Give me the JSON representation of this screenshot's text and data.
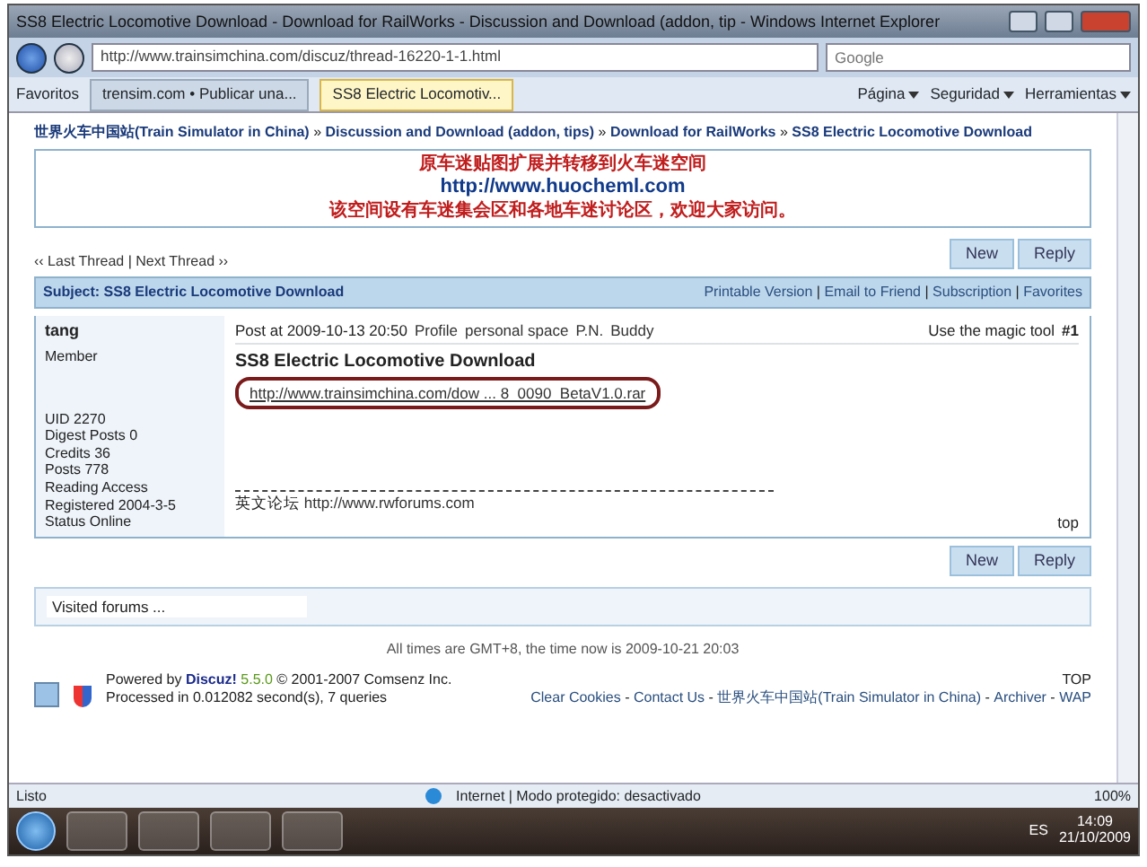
{
  "window": {
    "title": "SS8 Electric Locomotive Download - Download for RailWorks - Discussion and Download (addon, tip - Windows Internet Explorer"
  },
  "address_bar": {
    "url": "http://www.trainsimchina.com/discuz/thread-16220-1-1.html",
    "search_placeholder": "Google"
  },
  "favorites": "Favoritos",
  "tabs": [
    {
      "label": "trensim.com • Publicar una...",
      "selected": false
    },
    {
      "label": "SS8 Electric Locomotiv...",
      "selected": true
    }
  ],
  "command_menus": [
    "Página",
    "Seguridad",
    "Herramientas"
  ],
  "breadcrumb": [
    {
      "label": "世界火车中国站(Train Simulator in China)",
      "sep": "»"
    },
    {
      "label": "Discussion and Download (addon, tips)",
      "sep": "»"
    },
    {
      "label": "Download for RailWorks",
      "sep": "»"
    },
    {
      "label": "SS8 Electric Locomotive Download"
    }
  ],
  "banner": {
    "line_1": "原车迷贴图扩展并转移到火车迷空间",
    "url": "http://www.huocheml.com",
    "line_3": "该空间设有车迷集会区和各地车迷讨论区，欢迎大家访问。"
  },
  "thread_nav": {
    "prev": "‹‹ Last Thread",
    "sep": "|",
    "next": "Next Thread ››"
  },
  "buttons_top": [
    "New",
    "Reply"
  ],
  "subject": {
    "title": "Subject: SS8 Electric Locomotive Download",
    "links": [
      "Printable Version",
      "Email to Friend",
      "Subscription",
      "Favorites"
    ],
    "link_sep": "|"
  },
  "post": {
    "author": "tang",
    "rank": "Member",
    "stats": [
      "UID 2270",
      "Digest Posts 0",
      "Credits 36",
      "Posts 778",
      "Reading Access",
      "Registered 2004-3-5",
      "Status Online"
    ],
    "posted": "Post at 2009-10-13 20:50",
    "actions": [
      "Profile",
      "personal space",
      "P.N.",
      "Buddy"
    ],
    "magic": "Use the magic tool",
    "number": "#1",
    "title": "SS8 Electric Locomotive Download",
    "attachment": "http://www.trainsimchina.com/dow ... 8_0090_BetaV1.0.rar",
    "signature_label": "英文论坛",
    "signature_url": "http://www.rwforums.com",
    "top": "top"
  },
  "buttons_bottom": [
    "New",
    "Reply"
  ],
  "visited_forums": "Visited forums ...",
  "time_note": "All times are GMT+8, the time now is 2009-10-21 20:03",
  "footer": {
    "powered": "Powered by",
    "brand": "Discuz!",
    "version": "5.5.0",
    "copyright": "© 2001-2007 Comsenz Inc.",
    "processed": "Processed in 0.012082 second(s), 7 queries",
    "links": [
      "Clear Cookies",
      "Contact Us",
      "世界火车中国站(Train Simulator in China)",
      "Archiver",
      "WAP"
    ],
    "link_sep": "-",
    "top": "TOP"
  },
  "status_bar": {
    "left": "Listo",
    "zone": "Internet | Modo protegido: desactivado",
    "zoom": "100%"
  },
  "taskbar": {
    "language": "ES",
    "time": "14:09",
    "date": "21/10/2009"
  }
}
